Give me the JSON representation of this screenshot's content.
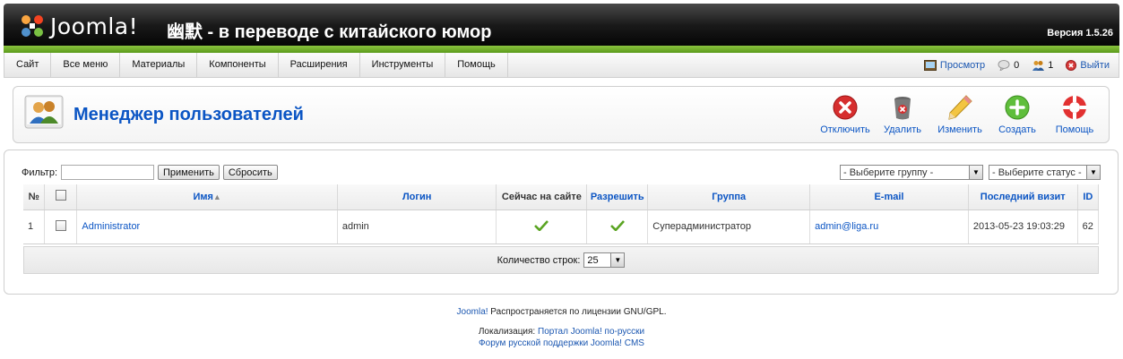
{
  "header": {
    "logo_text": "Joomla!",
    "site_title": "幽默 - в переводе с китайского юмор",
    "version": "Версия 1.5.26"
  },
  "menu": {
    "items": [
      "Сайт",
      "Все меню",
      "Материалы",
      "Компоненты",
      "Расширения",
      "Инструменты",
      "Помощь"
    ],
    "preview": "Просмотр",
    "messages_count": "0",
    "users_count": "1",
    "logout": "Выйти"
  },
  "toolbar": {
    "title": "Менеджер пользователей",
    "buttons": {
      "disable": "Отключить",
      "delete": "Удалить",
      "edit": "Изменить",
      "create": "Создать",
      "help": "Помощь"
    }
  },
  "filter": {
    "label": "Фильтр:",
    "value": "",
    "apply": "Применить",
    "reset": "Сбросить",
    "group_select": "- Выберите группу -",
    "status_select": "- Выберите статус -"
  },
  "table": {
    "headers": {
      "num": "№",
      "name": "Имя",
      "login": "Логин",
      "online": "Сейчас на сайте",
      "enabled": "Разрешить",
      "group": "Группа",
      "email": "E-mail",
      "last_visit": "Последний визит",
      "id": "ID"
    },
    "rows": [
      {
        "num": "1",
        "name": "Administrator",
        "login": "admin",
        "online": true,
        "enabled": true,
        "group": "Суперадминистратор",
        "email": "admin@liga.ru",
        "last_visit": "2013-05-23 19:03:29",
        "id": "62"
      }
    ]
  },
  "pager": {
    "label": "Количество строк:",
    "value": "25"
  },
  "footer": {
    "joomla": "Joomla!",
    "license": " Распространяется по лицензии GNU/GPL.",
    "localization_label": "Локализация: ",
    "portal": "Портал Joomla! по-русски",
    "forum": "Форум русской поддержки Joomla! CMS"
  },
  "colors": {
    "accent_blue": "#0b55c4",
    "green_bar": "#8bc43f",
    "header_dark": "#000000"
  }
}
